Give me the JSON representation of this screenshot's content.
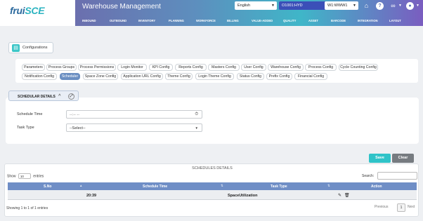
{
  "header": {
    "logo_main": "fruiSCE",
    "app_title": "Warehouse Management",
    "language": "English",
    "location": "O1001:HYD",
    "warehouse": "W1:WWW1",
    "nav": [
      "INBOUND",
      "OUTBOUND",
      "INVENTORY",
      "PLANNING",
      "WORKFORCE",
      "BILLING",
      "VALUE-ADDED",
      "QUALITY",
      "ASSET",
      "BARCODE",
      "INTEGRATION",
      "LAYOUT"
    ]
  },
  "config_chip": {
    "label": "Configurations"
  },
  "tabs": [
    "Parameters",
    "Process Groups",
    "Process Permissions",
    "Login Monitor",
    "KPI Config",
    "Reports Config",
    "Masters Config",
    "User Config",
    "Warehouse Config",
    "Process Config",
    "Cycle Counting Config",
    "Notification Config",
    "Scheduler",
    "Space Zone Config",
    "Application URL Config",
    "Theme Config",
    "Login Theme Config",
    "Status Config",
    "Prefix Config",
    "Financial Config"
  ],
  "active_tab": "Scheduler",
  "scheduler": {
    "section_title": "SCHEDULAR DETAILS",
    "schedule_time_label": "Schedule Time",
    "schedule_time_placeholder": "--:-- --",
    "task_type_label": "Task Type",
    "task_type_value": "--Select--"
  },
  "actions": {
    "save": "Save",
    "clear": "Clear"
  },
  "schedules": {
    "title": "SCHEDULES DETAILS",
    "show_label": "Show",
    "page_size": "10",
    "entries_label": "entries",
    "search_label": "Search:",
    "columns": [
      "S.No",
      "Schedule Time",
      "Task Type",
      "Action"
    ],
    "rows": [
      {
        "num": "1",
        "time": "20:39",
        "task": "SpaceUtilization"
      }
    ],
    "info": "Showing 1 to 1 of 1 entries",
    "prev": "Previous",
    "current_page": "1",
    "next": "Next"
  }
}
